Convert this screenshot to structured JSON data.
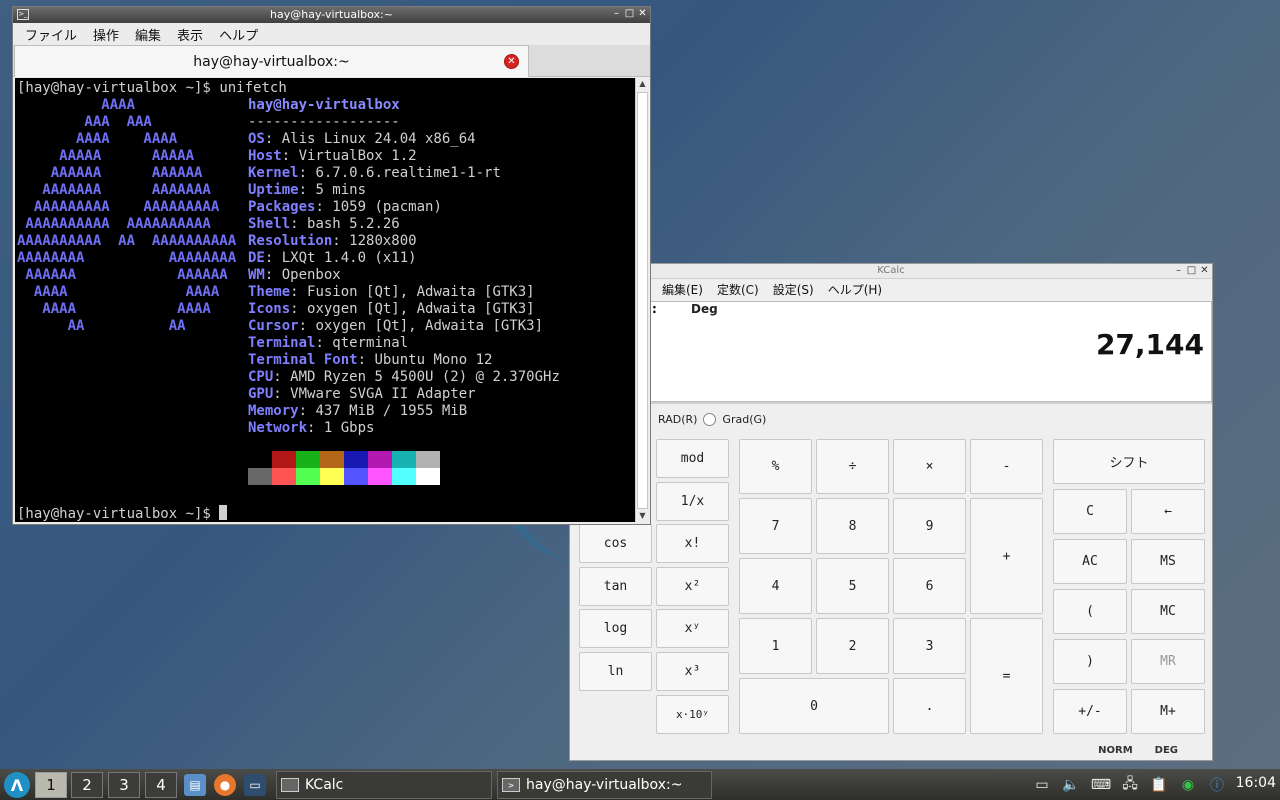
{
  "kcalc": {
    "title": "KCalc",
    "menu": [
      "編集(E)",
      "定数(C)",
      "設定(S)",
      "ヘルプ(H)"
    ],
    "display": {
      "mode": "Deg",
      "value": "27,144",
      "left_fragment": ":"
    },
    "angle": {
      "rad": "RAD(R)",
      "grad": "Grad(G)"
    },
    "buttons": {
      "mod": "mod",
      "inv": "1/x",
      "cos": "cos",
      "fact": "x!",
      "tan": "tan",
      "sq": "x²",
      "log": "log",
      "pow": "xʸ",
      "ln": "ln",
      "cube": "x³",
      "exp": "x·10ʸ",
      "percent": "%",
      "div": "÷",
      "mul": "×",
      "minus": "-",
      "n7": "7",
      "n8": "8",
      "n9": "9",
      "plus": "+",
      "n4": "4",
      "n5": "5",
      "n6": "6",
      "n1": "1",
      "n2": "2",
      "n3": "3",
      "equals": "=",
      "n0": "0",
      "dot": ".",
      "shift": "シフト",
      "clear": "C",
      "back": "←",
      "ac": "AC",
      "ms": "MS",
      "lparen": "(",
      "mc": "MC",
      "rparen": ")",
      "mr": "MR",
      "sign": "+/-",
      "mplus": "M+"
    },
    "status": [
      "NORM",
      "DEG"
    ]
  },
  "terminal": {
    "title": "hay@hay-virtualbox:~",
    "menu": [
      "ファイル",
      "操作",
      "編集",
      "表示",
      "ヘルプ"
    ],
    "tab_label": "hay@hay-virtualbox:~",
    "prompt": "[hay@hay-virtualbox ~]$",
    "command": "unifetch",
    "art": [
      "          AAAA",
      "        AAA  AAA",
      "       AAAA    AAAA",
      "     AAAAA      AAAAA",
      "    AAAAAA      AAAAAA",
      "   AAAAAAA      AAAAAAA",
      "  AAAAAAAAA    AAAAAAAAA",
      " AAAAAAAAAA  AAAAAAAAAA",
      "AAAAAAAAAA  AA  AAAAAAAAAA",
      "AAAAAAAA          AAAAAAAA",
      " AAAAAA            AAAAAA",
      "  AAAA              AAAA",
      "   AAAA            AAAA",
      "      AA          AA"
    ],
    "header": "hay@hay-virtualbox",
    "separator": "------------------",
    "info": [
      {
        "k": "OS",
        "v": "Alis Linux 24.04 x86_64"
      },
      {
        "k": "Host",
        "v": "VirtualBox 1.2"
      },
      {
        "k": "Kernel",
        "v": "6.7.0.6.realtime1-1-rt"
      },
      {
        "k": "Uptime",
        "v": "5 mins"
      },
      {
        "k": "Packages",
        "v": "1059 (pacman)"
      },
      {
        "k": "Shell",
        "v": "bash 5.2.26"
      },
      {
        "k": "Resolution",
        "v": "1280x800"
      },
      {
        "k": "DE",
        "v": "LXQt 1.4.0 (x11)"
      },
      {
        "k": "WM",
        "v": "Openbox"
      },
      {
        "k": "Theme",
        "v": "Fusion [Qt], Adwaita [GTK3]"
      },
      {
        "k": "Icons",
        "v": "oxygen [Qt], Adwaita [GTK3]"
      },
      {
        "k": "Cursor",
        "v": "oxygen [Qt], Adwaita [GTK3]"
      },
      {
        "k": "Terminal",
        "v": "qterminal"
      },
      {
        "k": "Terminal Font",
        "v": "Ubuntu Mono 12"
      },
      {
        "k": "CPU",
        "v": "AMD Ryzen 5 4500U (2) @ 2.370GHz"
      },
      {
        "k": "GPU",
        "v": "VMware SVGA II Adapter"
      },
      {
        "k": "Memory",
        "v": "437 MiB / 1955 MiB"
      },
      {
        "k": "Network",
        "v": "1 Gbps"
      }
    ],
    "palette": [
      "#000000",
      "#b21818",
      "#18b218",
      "#b26818",
      "#1818b2",
      "#b218b2",
      "#18b2b2",
      "#b2b2b2",
      "#686868",
      "#ff5454",
      "#54ff54",
      "#ffff54",
      "#5454ff",
      "#ff54ff",
      "#54ffff",
      "#ffffff"
    ]
  },
  "taskbar": {
    "workspaces": [
      "1",
      "2",
      "3",
      "4"
    ],
    "tasks": [
      "KCalc",
      "hay@hay-virtualbox:~"
    ],
    "clock": "16:04"
  }
}
